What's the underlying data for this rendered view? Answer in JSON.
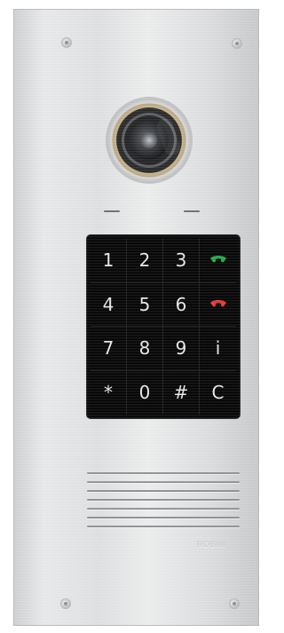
{
  "keypad": {
    "keys": [
      {
        "label": "1",
        "type": "digit"
      },
      {
        "label": "2",
        "type": "digit"
      },
      {
        "label": "3",
        "type": "digit"
      },
      {
        "label": "",
        "type": "call",
        "icon": "phone-green-icon",
        "color": "#1fa84a"
      },
      {
        "label": "4",
        "type": "digit"
      },
      {
        "label": "5",
        "type": "digit"
      },
      {
        "label": "6",
        "type": "digit"
      },
      {
        "label": "",
        "type": "hangup",
        "icon": "phone-red-icon",
        "color": "#e53935"
      },
      {
        "label": "7",
        "type": "digit"
      },
      {
        "label": "8",
        "type": "digit"
      },
      {
        "label": "9",
        "type": "digit"
      },
      {
        "label": "i",
        "type": "info"
      },
      {
        "label": "*",
        "type": "symbol"
      },
      {
        "label": "0",
        "type": "digit"
      },
      {
        "label": "#",
        "type": "symbol"
      },
      {
        "label": "C",
        "type": "clear"
      }
    ]
  },
  "brand_text": "ROBIN",
  "colors": {
    "panel": "#e2e3e5",
    "keypad": "#050505",
    "key_text": "#e7e7e7",
    "call_green": "#1fa84a",
    "hangup_red": "#e53935"
  }
}
